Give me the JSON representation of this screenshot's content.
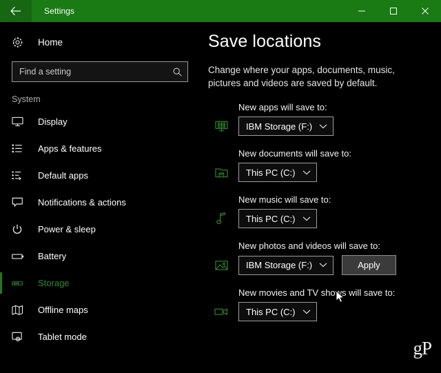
{
  "window": {
    "title": "Settings",
    "back_icon": "back-arrow-icon",
    "minimize_label": "Minimize",
    "maximize_label": "Maximize",
    "close_label": "Close",
    "titlebar_color": "#1a7a14"
  },
  "sidebar": {
    "home": {
      "label": "Home",
      "icon": "gear-icon"
    },
    "search": {
      "placeholder": "Find a setting",
      "value": "",
      "icon": "search-icon"
    },
    "section_label": "System",
    "accent_color": "#2e8b2e",
    "items": [
      {
        "label": "Display",
        "icon": "monitor-icon",
        "selected": false
      },
      {
        "label": "Apps & features",
        "icon": "list-icon",
        "selected": false
      },
      {
        "label": "Default apps",
        "icon": "list-arrow-icon",
        "selected": false
      },
      {
        "label": "Notifications & actions",
        "icon": "speech-bubble-icon",
        "selected": false
      },
      {
        "label": "Power & sleep",
        "icon": "power-icon",
        "selected": false
      },
      {
        "label": "Battery",
        "icon": "battery-icon",
        "selected": false
      },
      {
        "label": "Storage",
        "icon": "storage-icon",
        "selected": true
      },
      {
        "label": "Offline maps",
        "icon": "map-icon",
        "selected": false
      },
      {
        "label": "Tablet mode",
        "icon": "tablet-icon",
        "selected": false
      }
    ]
  },
  "main": {
    "title": "Save locations",
    "description": "Change where your apps, documents, music, pictures and videos are saved by default.",
    "icon_color": "#2f8f2f",
    "groups": [
      {
        "label": "New apps will save to:",
        "icon": "apps-monitor-icon",
        "value": "IBM Storage (F:)",
        "has_apply": false
      },
      {
        "label": "New documents will save to:",
        "icon": "folder-save-icon",
        "value": "This PC (C:)",
        "has_apply": false
      },
      {
        "label": "New music will save to:",
        "icon": "music-note-icon",
        "value": "This PC (C:)",
        "has_apply": false
      },
      {
        "label": "New photos and videos will save to:",
        "icon": "picture-icon",
        "value": "IBM Storage (F:)",
        "has_apply": true
      },
      {
        "label": "New movies and TV shows will save to:",
        "icon": "video-camera-icon",
        "value": "This PC (C:)",
        "has_apply": false
      }
    ],
    "apply_label": "Apply",
    "watermark": "gP"
  }
}
